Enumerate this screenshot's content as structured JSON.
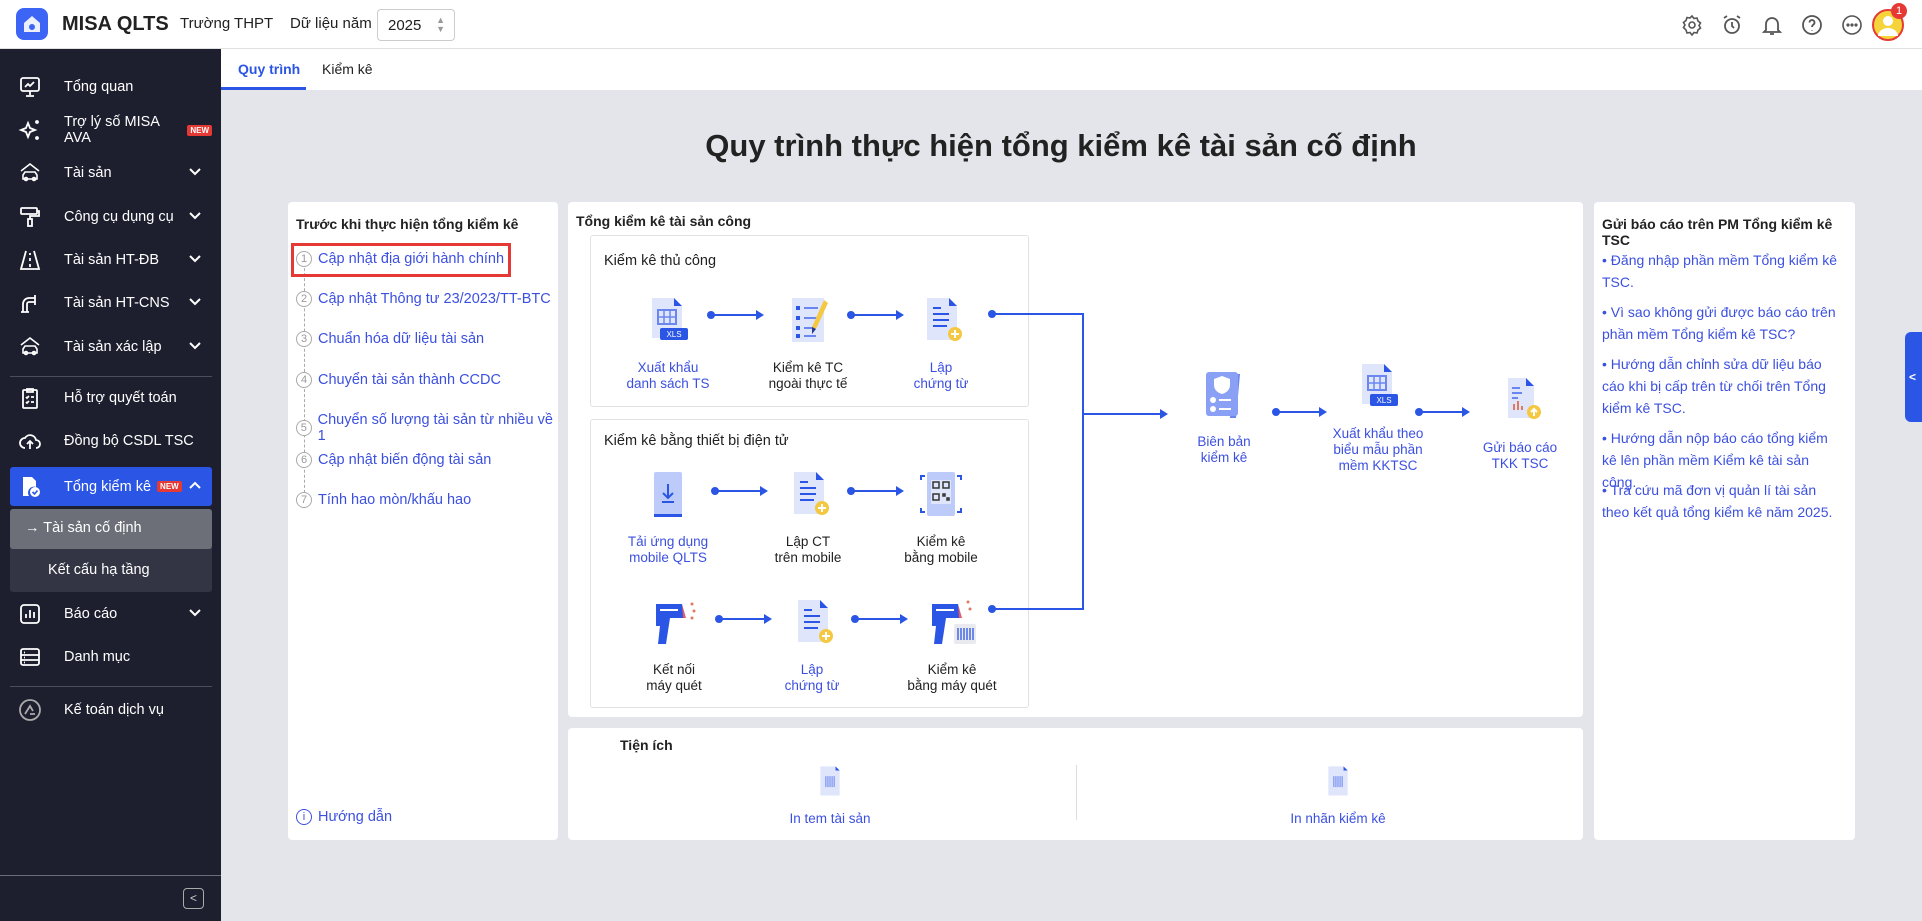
{
  "header": {
    "app_name": "MISA QLTS",
    "org": "Trường THPT",
    "year_label": "Dữ liệu năm",
    "year_value": "2025",
    "notification_count": "1",
    "icons": [
      "gear-icon",
      "alarm-icon",
      "bell-icon",
      "help-icon",
      "more-icon"
    ]
  },
  "sidebar": {
    "items": [
      {
        "label": "Tổng quan",
        "icon": "monitor-chart-icon"
      },
      {
        "label": "Trợ lý số MISA AVA",
        "icon": "sparkle-icon",
        "badge": "NEW"
      },
      {
        "label": "Tài sản",
        "icon": "house-car-icon",
        "expandable": true
      },
      {
        "label": "Công cụ dụng cụ",
        "icon": "paint-roller-icon",
        "expandable": true
      },
      {
        "label": "Tài sản HT-ĐB",
        "icon": "road-icon",
        "expandable": true
      },
      {
        "label": "Tài sản HT-CNS",
        "icon": "pipe-icon",
        "expandable": true
      },
      {
        "label": "Tài sản xác lập",
        "icon": "house-car-icon",
        "expandable": true
      },
      {
        "label": "Hỗ trợ quyết toán",
        "icon": "clipboard-icon"
      },
      {
        "label": "Đồng bộ CSDL TSC",
        "icon": "cloud-upload-icon"
      },
      {
        "label": "Tổng kiểm kê",
        "icon": "doc-check-icon",
        "badge": "NEW",
        "active": true
      },
      {
        "label": "Báo cáo",
        "icon": "bar-chart-icon",
        "expandable": true
      },
      {
        "label": "Danh mục",
        "icon": "list-icon"
      },
      {
        "label": "Kế toán dịch vụ",
        "icon": "service-logo-icon"
      }
    ],
    "subitems": [
      {
        "label": "Tài sản cố định",
        "active": true,
        "prefix": "→"
      },
      {
        "label": "Kết cấu hạ tầng"
      }
    ]
  },
  "tabs": [
    {
      "label": "Quy trình",
      "active": true
    },
    {
      "label": "Kiểm kê"
    }
  ],
  "colors": {
    "accent": "#2a55e5",
    "sidebar_bg": "#1d1f2e",
    "link": "#3c50e0",
    "highlight_box": "#e53935"
  },
  "main": {
    "title": "Quy trình thực hiện tổng kiểm kê tài sản cố định",
    "before": {
      "title": "Trước khi thực hiện tổng kiểm kê",
      "steps": [
        {
          "num": "1",
          "label": "Cập nhật địa giới hành chính",
          "highlighted": true
        },
        {
          "num": "2",
          "label": "Cập nhật Thông tư 23/2023/TT-BTC"
        },
        {
          "num": "3",
          "label": "Chuẩn hóa dữ liệu tài sản"
        },
        {
          "num": "4",
          "label": "Chuyển tài sản thành CCDC"
        },
        {
          "num": "5",
          "label": "Chuyển số lượng tài sản từ nhiều về 1"
        },
        {
          "num": "6",
          "label": "Cập nhật biến động tài sản"
        },
        {
          "num": "7",
          "label": "Tính hao mòn/khấu hao"
        }
      ],
      "guide": "Hướng dẫn"
    },
    "process": {
      "title": "Tổng kiểm kê tài sản công",
      "manual": {
        "title": "Kiểm kê thủ công",
        "nodes": [
          {
            "l1": "Xuất khẩu",
            "l2": "danh sách TS",
            "link": true
          },
          {
            "l1": "Kiểm kê TC",
            "l2": "ngoài thực tế"
          },
          {
            "l1": "Lập",
            "l2": "chứng từ",
            "link": true
          }
        ]
      },
      "electronic": {
        "title": "Kiểm kê bằng thiết bị điện tử",
        "row1": [
          {
            "l1": "Tải ứng dụng",
            "l2": "mobile QLTS",
            "link": true
          },
          {
            "l1": "Lập CT",
            "l2": "trên mobile"
          },
          {
            "l1": "Kiểm kê",
            "l2": "bằng mobile"
          }
        ],
        "row2": [
          {
            "l1": "Kết nối",
            "l2": "máy quét"
          },
          {
            "l1": "Lập",
            "l2": "chứng từ",
            "link": true
          },
          {
            "l1": "Kiểm kê",
            "l2": "bằng máy quét"
          }
        ]
      },
      "final": [
        {
          "l1": "Biên bản",
          "l2": "kiểm kê"
        },
        {
          "l1": "Xuất khẩu theo",
          "l2": "biểu mẫu phần",
          "l3": "mềm KKTSC"
        },
        {
          "l1": "Gửi báo cáo",
          "l2": "TKK TSC"
        }
      ]
    },
    "utilities": {
      "title": "Tiện ích",
      "items": [
        "In tem tài sản",
        "In nhãn kiểm kê"
      ]
    },
    "report": {
      "title": "Gửi báo cáo trên PM Tổng kiểm kê TSC",
      "links": [
        "• Đăng nhập phần mềm Tổng kiểm kê TSC.",
        "• Vì sao không gửi được báo cáo trên phần mềm Tổng kiểm kê TSC?",
        "• Hướng dẫn chỉnh sửa dữ liệu báo cáo khi bị cấp trên từ chối trên Tổng kiểm kê TSC.",
        "• Hướng dẫn nộp báo cáo tổng kiểm kê lên phần mềm Kiểm kê tài sản công.",
        "• Tra cứu mã đơn vị quản lí tài sản theo kết quả tổng kiểm kê năm 2025."
      ]
    }
  }
}
